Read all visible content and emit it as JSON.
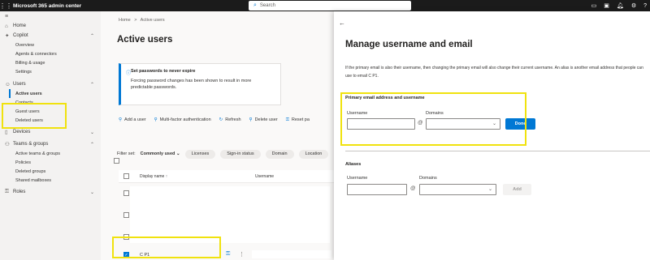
{
  "topbar": {
    "app_title": "Microsoft 365 admin center",
    "search_placeholder": "Search",
    "icons": [
      "waffle-icon",
      "search-icon",
      "screen-icon",
      "desktop-icon",
      "bell-icon",
      "settings-icon",
      "help-icon"
    ]
  },
  "sidebar": {
    "items": [
      {
        "label": "Home",
        "icon": "home-icon"
      },
      {
        "label": "Copilot",
        "icon": "copilot-icon"
      },
      {
        "label": "Overview"
      },
      {
        "label": "Agents & connectors"
      },
      {
        "label": "Billing & usage"
      },
      {
        "label": "Settings"
      },
      {
        "label": "Users",
        "icon": "user-icon"
      },
      {
        "label": "Active users"
      },
      {
        "label": "Contacts"
      },
      {
        "label": "Guest users"
      },
      {
        "label": "Deleted users"
      },
      {
        "label": "Devices",
        "icon": "devices-icon"
      },
      {
        "label": "Teams & groups",
        "icon": "groups-icon"
      },
      {
        "label": "Active teams & groups"
      },
      {
        "label": "Policies"
      },
      {
        "label": "Deleted groups"
      },
      {
        "label": "Shared mailboxes"
      },
      {
        "label": "Roles",
        "icon": "key-icon"
      }
    ]
  },
  "main": {
    "breadcrumb": {
      "home": "Home",
      "sep": ">",
      "current": "Active users"
    },
    "title": "Active users",
    "notice": {
      "title": "Set passwords to never expire",
      "body": "Forcing password changes has been shown to result in more predictable passwords."
    },
    "toolbar": [
      {
        "label": "Add a user",
        "icon": "add-user-icon"
      },
      {
        "label": "Multi-factor authentication",
        "icon": "mfa-icon"
      },
      {
        "label": "Refresh",
        "icon": "refresh-icon"
      },
      {
        "label": "Delete user",
        "icon": "delete-user-icon"
      },
      {
        "label": "Reset pa",
        "icon": "key-icon"
      }
    ],
    "filters": {
      "label": "Filter set:",
      "current": "Commonly used",
      "pills": [
        "Licenses",
        "Sign-in status",
        "Domain",
        "Location"
      ]
    },
    "table": {
      "headers": [
        "Display name",
        "Username"
      ],
      "sort_arrow": "↑",
      "rows": [
        {
          "display_name": "",
          "selected": false
        },
        {
          "display_name": "",
          "selected": false
        },
        {
          "display_name": "",
          "selected": false
        },
        {
          "display_name": "C P1",
          "selected": true
        }
      ]
    }
  },
  "panel": {
    "back_icon": "back-arrow-icon",
    "title": "Manage username and email",
    "description": "If the primary email is also their username, then changing the primary email will also change their current username. An alias is another email address that people can use to email C P1.",
    "primary_section": {
      "title": "Primary email address and username",
      "username_label": "Username",
      "username_value": "",
      "at": "@",
      "domains_label": "Domains",
      "domains_value": "",
      "done_label": "Done"
    },
    "aliases_section": {
      "title": "Aliases",
      "username_label": "Username",
      "username_value": "",
      "at": "@",
      "domains_label": "Domains",
      "domains_value": "",
      "add_label": "Add"
    }
  },
  "colors": {
    "topbar": "#1b1b1b",
    "accent": "#0078d4",
    "highlight": "#f0e20e"
  }
}
